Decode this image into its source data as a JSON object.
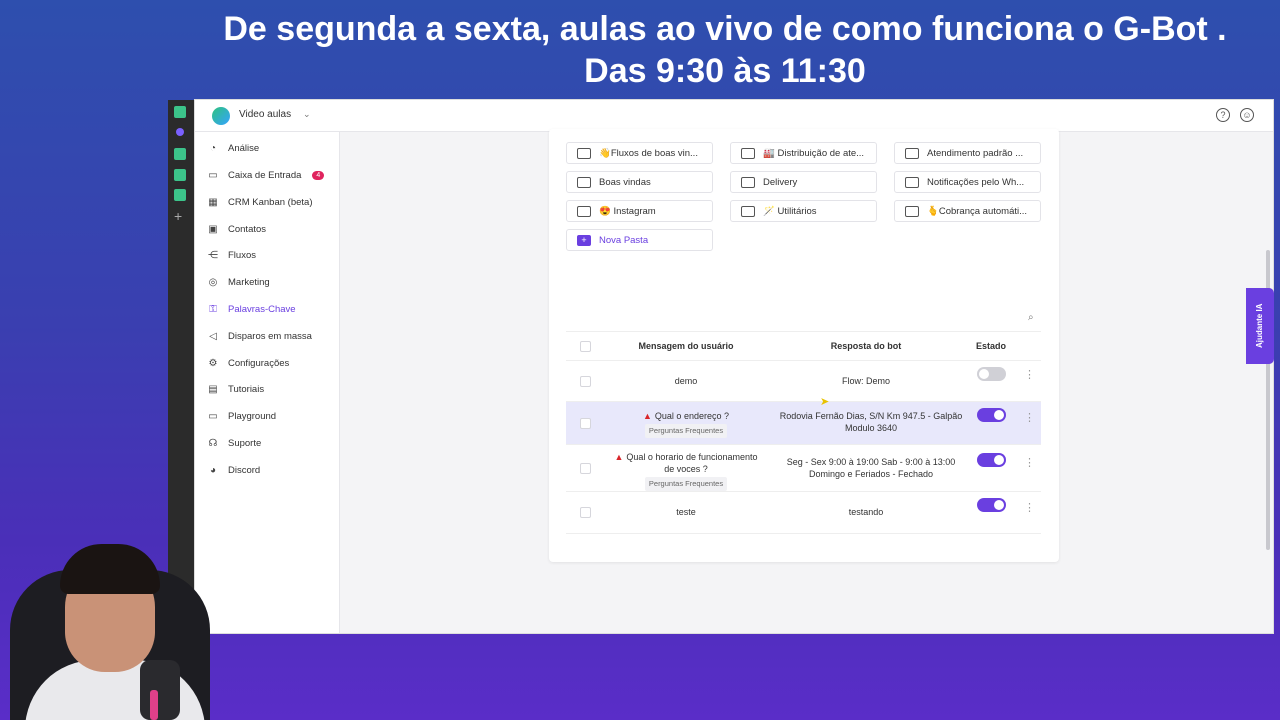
{
  "banner": {
    "line1": "De segunda a sexta, aulas ao vivo de como funciona o G-Bot .",
    "line2": "Das 9:30 às 11:30"
  },
  "topbar": {
    "workspace": "Video aulas",
    "help_icon": "help-circle-icon",
    "user_icon": "user-circle-icon"
  },
  "sidebar": {
    "items": [
      {
        "label": "Análise",
        "icon": "chart-pie-icon"
      },
      {
        "label": "Caixa de Entrada",
        "icon": "inbox-icon",
        "badge": "4"
      },
      {
        "label": "CRM Kanban (beta)",
        "icon": "kanban-icon"
      },
      {
        "label": "Contatos",
        "icon": "contacts-icon"
      },
      {
        "label": "Fluxos",
        "icon": "flow-icon"
      },
      {
        "label": "Marketing",
        "icon": "marketing-icon"
      },
      {
        "label": "Palavras-Chave",
        "icon": "key-icon"
      },
      {
        "label": "Disparos em massa",
        "icon": "megaphone-icon"
      },
      {
        "label": "Configurações",
        "icon": "gear-icon"
      },
      {
        "label": "Tutoriais",
        "icon": "video-icon"
      },
      {
        "label": "Playground",
        "icon": "laptop-icon"
      },
      {
        "label": "Suporte",
        "icon": "headset-icon"
      },
      {
        "label": "Discord",
        "icon": "discord-icon"
      }
    ],
    "active": "Palavras-Chave"
  },
  "folders": [
    "👋Fluxos de boas vin...",
    "🏭 Distribuição de ate...",
    "Atendimento padrão ...",
    "Boas vindas",
    "Delivery",
    "Notificações pelo Wh...",
    "😍 Instagram",
    "🪄 Utilitários",
    "🫰Cobrança automáti...",
    "Nova Pasta"
  ],
  "table": {
    "headers": [
      "Mensagem do usuário",
      "Resposta do bot",
      "Estado"
    ],
    "rows": [
      {
        "message": "demo",
        "tag": "",
        "response": "Flow: Demo",
        "enabled": false
      },
      {
        "message": "Qual o endereço ?",
        "tag": "Perguntas Frequentes",
        "response": "Rodovia Fernão Dias, S/N Km 947.5 - Galpão Modulo 3640",
        "enabled": true
      },
      {
        "message": "Qual o horario de funcionamento de voces ?",
        "tag": "Perguntas Frequentes",
        "response": "Seg - Sex 9:00 à 19:00 Sab - 9:00 à 13:00 Domingo e Feriados - Fechado",
        "enabled": true
      },
      {
        "message": "teste",
        "tag": "",
        "response": "testando",
        "enabled": true
      }
    ]
  },
  "side_tab": "Ajudante IA",
  "colors": {
    "accent": "#6a3fe0",
    "badge": "#e0245e",
    "warning": "#d9262b"
  }
}
